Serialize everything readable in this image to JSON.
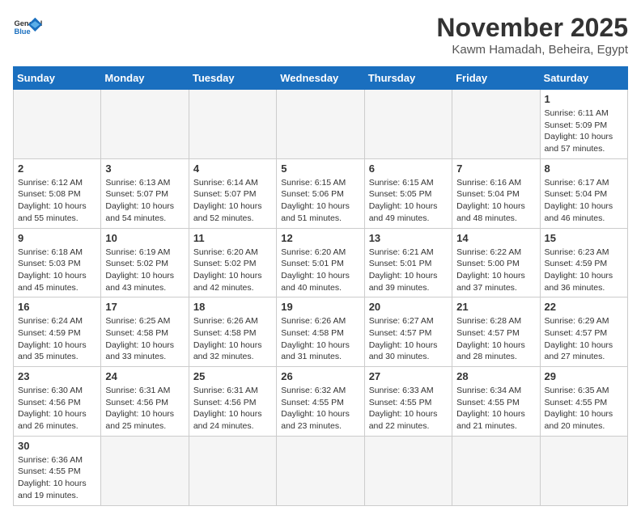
{
  "header": {
    "logo_general": "General",
    "logo_blue": "Blue",
    "month_title": "November 2025",
    "location": "Kawm Hamadah, Beheira, Egypt"
  },
  "weekdays": [
    "Sunday",
    "Monday",
    "Tuesday",
    "Wednesday",
    "Thursday",
    "Friday",
    "Saturday"
  ],
  "weeks": [
    [
      {
        "day": "",
        "info": ""
      },
      {
        "day": "",
        "info": ""
      },
      {
        "day": "",
        "info": ""
      },
      {
        "day": "",
        "info": ""
      },
      {
        "day": "",
        "info": ""
      },
      {
        "day": "",
        "info": ""
      },
      {
        "day": "1",
        "info": "Sunrise: 6:11 AM\nSunset: 5:09 PM\nDaylight: 10 hours and 57 minutes."
      }
    ],
    [
      {
        "day": "2",
        "info": "Sunrise: 6:12 AM\nSunset: 5:08 PM\nDaylight: 10 hours and 55 minutes."
      },
      {
        "day": "3",
        "info": "Sunrise: 6:13 AM\nSunset: 5:07 PM\nDaylight: 10 hours and 54 minutes."
      },
      {
        "day": "4",
        "info": "Sunrise: 6:14 AM\nSunset: 5:07 PM\nDaylight: 10 hours and 52 minutes."
      },
      {
        "day": "5",
        "info": "Sunrise: 6:15 AM\nSunset: 5:06 PM\nDaylight: 10 hours and 51 minutes."
      },
      {
        "day": "6",
        "info": "Sunrise: 6:15 AM\nSunset: 5:05 PM\nDaylight: 10 hours and 49 minutes."
      },
      {
        "day": "7",
        "info": "Sunrise: 6:16 AM\nSunset: 5:04 PM\nDaylight: 10 hours and 48 minutes."
      },
      {
        "day": "8",
        "info": "Sunrise: 6:17 AM\nSunset: 5:04 PM\nDaylight: 10 hours and 46 minutes."
      }
    ],
    [
      {
        "day": "9",
        "info": "Sunrise: 6:18 AM\nSunset: 5:03 PM\nDaylight: 10 hours and 45 minutes."
      },
      {
        "day": "10",
        "info": "Sunrise: 6:19 AM\nSunset: 5:02 PM\nDaylight: 10 hours and 43 minutes."
      },
      {
        "day": "11",
        "info": "Sunrise: 6:20 AM\nSunset: 5:02 PM\nDaylight: 10 hours and 42 minutes."
      },
      {
        "day": "12",
        "info": "Sunrise: 6:20 AM\nSunset: 5:01 PM\nDaylight: 10 hours and 40 minutes."
      },
      {
        "day": "13",
        "info": "Sunrise: 6:21 AM\nSunset: 5:01 PM\nDaylight: 10 hours and 39 minutes."
      },
      {
        "day": "14",
        "info": "Sunrise: 6:22 AM\nSunset: 5:00 PM\nDaylight: 10 hours and 37 minutes."
      },
      {
        "day": "15",
        "info": "Sunrise: 6:23 AM\nSunset: 4:59 PM\nDaylight: 10 hours and 36 minutes."
      }
    ],
    [
      {
        "day": "16",
        "info": "Sunrise: 6:24 AM\nSunset: 4:59 PM\nDaylight: 10 hours and 35 minutes."
      },
      {
        "day": "17",
        "info": "Sunrise: 6:25 AM\nSunset: 4:58 PM\nDaylight: 10 hours and 33 minutes."
      },
      {
        "day": "18",
        "info": "Sunrise: 6:26 AM\nSunset: 4:58 PM\nDaylight: 10 hours and 32 minutes."
      },
      {
        "day": "19",
        "info": "Sunrise: 6:26 AM\nSunset: 4:58 PM\nDaylight: 10 hours and 31 minutes."
      },
      {
        "day": "20",
        "info": "Sunrise: 6:27 AM\nSunset: 4:57 PM\nDaylight: 10 hours and 30 minutes."
      },
      {
        "day": "21",
        "info": "Sunrise: 6:28 AM\nSunset: 4:57 PM\nDaylight: 10 hours and 28 minutes."
      },
      {
        "day": "22",
        "info": "Sunrise: 6:29 AM\nSunset: 4:57 PM\nDaylight: 10 hours and 27 minutes."
      }
    ],
    [
      {
        "day": "23",
        "info": "Sunrise: 6:30 AM\nSunset: 4:56 PM\nDaylight: 10 hours and 26 minutes."
      },
      {
        "day": "24",
        "info": "Sunrise: 6:31 AM\nSunset: 4:56 PM\nDaylight: 10 hours and 25 minutes."
      },
      {
        "day": "25",
        "info": "Sunrise: 6:31 AM\nSunset: 4:56 PM\nDaylight: 10 hours and 24 minutes."
      },
      {
        "day": "26",
        "info": "Sunrise: 6:32 AM\nSunset: 4:55 PM\nDaylight: 10 hours and 23 minutes."
      },
      {
        "day": "27",
        "info": "Sunrise: 6:33 AM\nSunset: 4:55 PM\nDaylight: 10 hours and 22 minutes."
      },
      {
        "day": "28",
        "info": "Sunrise: 6:34 AM\nSunset: 4:55 PM\nDaylight: 10 hours and 21 minutes."
      },
      {
        "day": "29",
        "info": "Sunrise: 6:35 AM\nSunset: 4:55 PM\nDaylight: 10 hours and 20 minutes."
      }
    ],
    [
      {
        "day": "30",
        "info": "Sunrise: 6:36 AM\nSunset: 4:55 PM\nDaylight: 10 hours and 19 minutes."
      },
      {
        "day": "",
        "info": ""
      },
      {
        "day": "",
        "info": ""
      },
      {
        "day": "",
        "info": ""
      },
      {
        "day": "",
        "info": ""
      },
      {
        "day": "",
        "info": ""
      },
      {
        "day": "",
        "info": ""
      }
    ]
  ]
}
